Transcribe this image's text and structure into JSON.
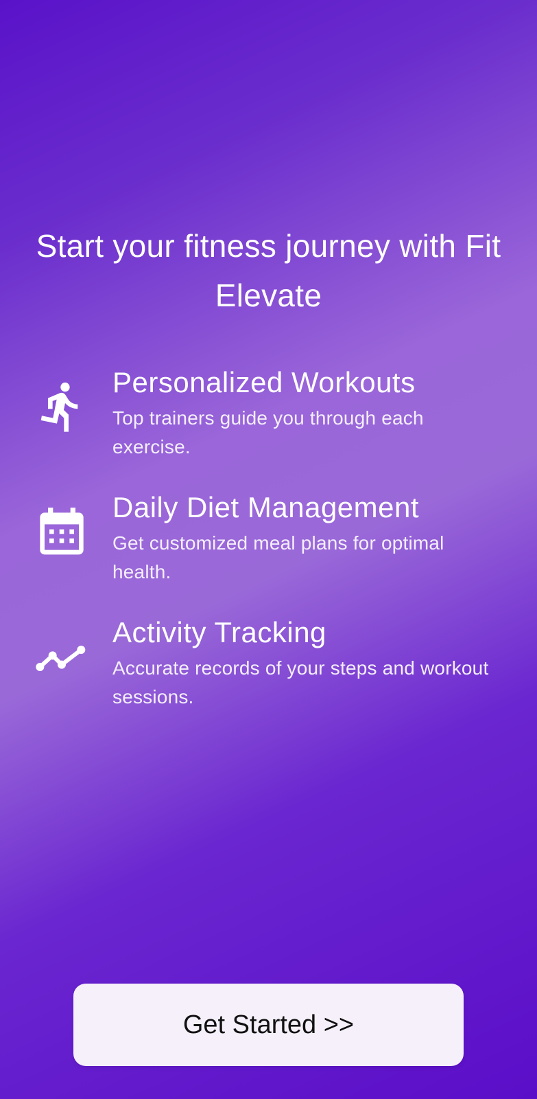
{
  "headline": "Start your fitness journey with Fit Elevate",
  "features": [
    {
      "icon": "running-person-icon",
      "title": "Personalized Workouts",
      "description": "Top trainers guide you through each exercise."
    },
    {
      "icon": "calendar-icon",
      "title": "Daily Diet Management",
      "description": "Get customized meal plans for optimal health."
    },
    {
      "icon": "trending-line-icon",
      "title": "Activity Tracking",
      "description": "Accurate records of your steps and workout sessions."
    }
  ],
  "cta": {
    "label": "Get Started >>"
  },
  "colors": {
    "gradient_dark": "#5a12c9",
    "gradient_light": "#9a66d9",
    "text": "#ffffff",
    "button_bg": "#f6f0fa",
    "button_text": "#111111"
  }
}
